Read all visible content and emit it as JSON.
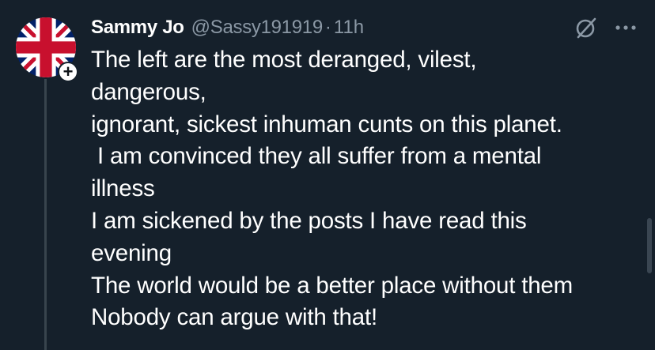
{
  "tweet": {
    "author": {
      "display_name": "Sammy Jo",
      "handle": "@Sassy191919",
      "avatar_icon": "union-jack-flag-avatar"
    },
    "separator": "·",
    "time": "11h",
    "follow_badge": "+",
    "lines": [
      "The left are the most deranged, vilest,",
      "dangerous,",
      "ignorant, sickest inhuman cunts on this planet.",
      " I am convinced they all suffer from a mental",
      "illness",
      "I am sickened by the posts I have read this",
      "evening",
      "The world would be a better place without them",
      "Nobody can argue with that!"
    ]
  },
  "icons": {
    "mute": "grok-slash-icon",
    "more": "more-options-icon"
  },
  "colors": {
    "background": "#15202b",
    "text_primary": "#ffffff",
    "text_secondary": "#8b98a5",
    "thread_line": "#38444d"
  }
}
